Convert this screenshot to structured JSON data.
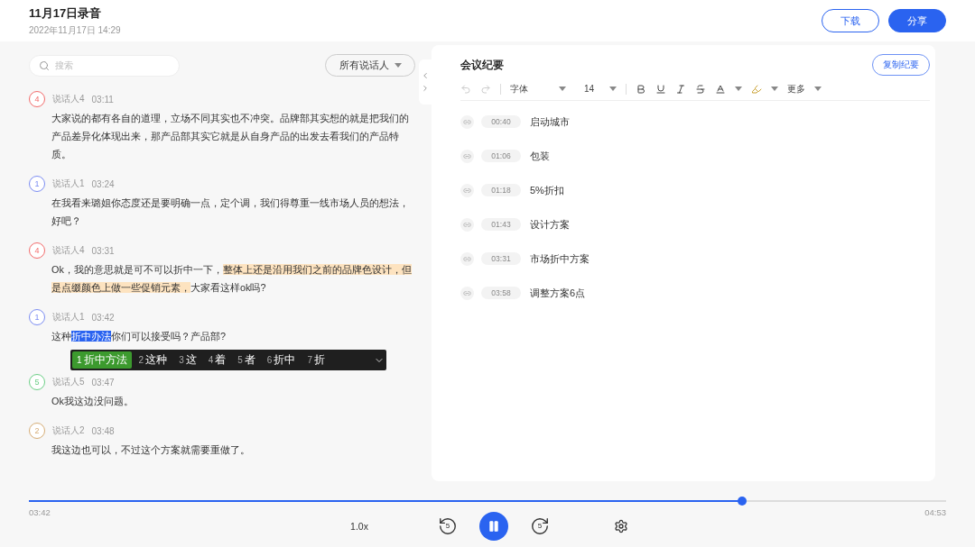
{
  "header": {
    "title": "11月17日录音",
    "subtitle": "2022年11月17日 14:29",
    "buttons": [
      {
        "label": "下载",
        "kind": "outline"
      },
      {
        "label": "分享",
        "kind": "primary"
      }
    ]
  },
  "transcript": {
    "search": {
      "placeholder": "搜索"
    },
    "speaker_filter": "所有说话人",
    "entries": [
      {
        "avatar": "4",
        "color": "#f26b6b",
        "speaker": "说话人4",
        "time": "03:11",
        "segments": [
          {
            "text": "大家说的都有各自的道理，立场不同其实也不冲突。品牌部其实想的就是把我们的产品差异化体现出来，那产品部其实它就是从自身产品的出发去看我们的产品特质。",
            "kind": "plain"
          }
        ]
      },
      {
        "avatar": "1",
        "color": "#7b8cf2",
        "speaker": "说话人1",
        "time": "03:24",
        "segments": [
          {
            "text": "在我看来璐姐你态度还是要明确一点，定个调，我们得尊重一线市场人员的想法，好吧？",
            "kind": "plain"
          }
        ]
      },
      {
        "avatar": "4",
        "color": "#f26b6b",
        "speaker": "说话人4",
        "time": "03:31",
        "segments": [
          {
            "text": " Ok，我的意思就是可不可以折中一下，",
            "kind": "plain"
          },
          {
            "text": "整体上还是沿用我们之前的品牌色设计，但是点缀颜色上做一些促销元素，",
            "kind": "highlight"
          },
          {
            "text": "大家看这样ok吗?",
            "kind": "plain"
          }
        ]
      },
      {
        "avatar": "1",
        "color": "#7b8cf2",
        "speaker": "说话人1",
        "time": "03:42",
        "segments": [
          {
            "text": "这种",
            "kind": "plain"
          },
          {
            "text": "折中办法",
            "kind": "selection"
          },
          {
            "text": "你们可以接受吗？产品部?",
            "kind": "plain"
          }
        ],
        "ime": [
          {
            "key": "1",
            "word": "折中方法",
            "selected": true
          },
          {
            "key": "2",
            "word": "这种",
            "selected": false
          },
          {
            "key": "3",
            "word": "这",
            "selected": false
          },
          {
            "key": "4",
            "word": "着",
            "selected": false
          },
          {
            "key": "5",
            "word": "者",
            "selected": false
          },
          {
            "key": "6",
            "word": "折中",
            "selected": false
          },
          {
            "key": "7",
            "word": "折",
            "selected": false
          }
        ]
      },
      {
        "avatar": "5",
        "color": "#6ccf86",
        "speaker": "说话人5",
        "time": "03:47",
        "segments": [
          {
            "text": "Ok我这边没问题。",
            "kind": "plain"
          }
        ]
      },
      {
        "avatar": "2",
        "color": "#d6ad76",
        "speaker": "说话人2",
        "time": "03:48",
        "segments": [
          {
            "text": "我这边也可以，不过这个方案就需要重做了。",
            "kind": "plain"
          }
        ]
      }
    ]
  },
  "minutes": {
    "title": "会议纪要",
    "copy_button": "复制纪要",
    "toolbar": {
      "undo_disabled": true,
      "redo_disabled": true,
      "font": "字体",
      "size": "14",
      "more": "更多"
    },
    "items": [
      {
        "time": "00:40",
        "text": "启动城市"
      },
      {
        "time": "01:06",
        "text": "包装"
      },
      {
        "time": "01:18",
        "text": "5%折扣"
      },
      {
        "time": "01:43",
        "text": "设计方案"
      },
      {
        "time": "03:31",
        "text": "市场折中方案"
      },
      {
        "time": "03:58",
        "text": "调整方案6点"
      }
    ]
  },
  "player": {
    "level": 0.778,
    "current": "03:42",
    "total": "04:53",
    "speed": "1.0x",
    "playing": true,
    "skip_back": "5",
    "skip_forward": "5"
  }
}
